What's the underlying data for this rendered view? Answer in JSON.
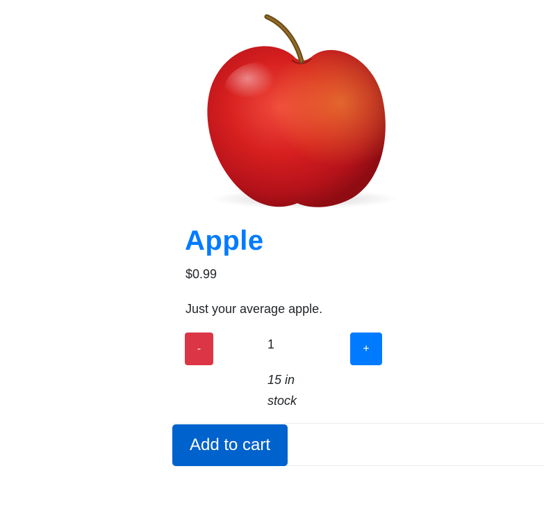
{
  "product": {
    "name": "Apple",
    "price": "$0.99",
    "description": "Just your average apple.",
    "image_icon": "apple-image"
  },
  "quantity": {
    "decrement_label": "-",
    "value": "1",
    "increment_label": "+",
    "stock": "15 in stock"
  },
  "actions": {
    "add_to_cart_label": "Add to cart"
  },
  "colors": {
    "title": "#007bff",
    "decrement": "#dc3545",
    "increment": "#007bff",
    "add_to_cart": "#0062cc"
  }
}
